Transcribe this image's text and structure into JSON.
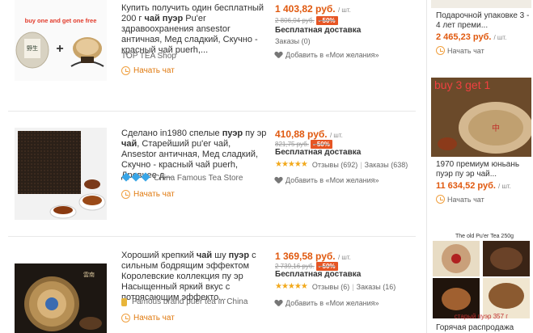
{
  "items": [
    {
      "banner_text": "buy one and get one free",
      "title_pre": "Купить получить один бесплатный 200 г ",
      "title_bold": "чай пуэр",
      "title_post": " Pu'er здравоохранения ansestor античная, Мед сладкий, Скучно - красный чай puerh,...",
      "store": "TOP TEA Shop",
      "chat": "Начать чат",
      "price": "1 403,82 руб.",
      "unit": "/ шт.",
      "old_price": "2 806,04 руб.",
      "discount": "- 50%",
      "shipping": "Бесплатная доставка",
      "orders": "Заказы (0)",
      "wishlist": "Добавить в «Мои желания»"
    },
    {
      "title_pre": "Сделано in1980 спелые ",
      "title_bold": "пуэр",
      "title_mid": " пу эр ",
      "title_bold2": "чай",
      "title_post": ", Старейший pu'er чай, Ansestor античная, Мед сладкий, Скучно - красный чай puerh, Древнее д...",
      "store": "China Famous Tea Store",
      "chat": "Начать чат",
      "price": "410,88 руб.",
      "unit": "/ шт.",
      "old_price": "821,75 руб.",
      "discount": "- 50%",
      "shipping": "Бесплатная доставка",
      "rating_stars": "★★★★★",
      "reviews": "Отзывы (692)",
      "orders": "Заказы (638)",
      "wishlist": "Добавить в «Мои желания»"
    },
    {
      "title_pre": "Хороший крепкий ",
      "title_bold": "чай",
      "title_mid": " шу ",
      "title_bold2": "пуэр",
      "title_post": " с сильным бодрящим эффектом Королевские коллекция пу эр Насыщенный яркий вкус с потрясающим эффекто...",
      "store": "Famous brand puer tea in China",
      "chat": "Начать чат",
      "price": "1 369,58 руб.",
      "unit": "/ шт.",
      "old_price": "2 739,16 руб.",
      "discount": "- 50%",
      "shipping": "Бесплатная доставка",
      "rating_stars": "★★★★★",
      "reviews": "Отзывы (6)",
      "orders": "Заказы (16)",
      "wishlist": "Добавить в «Мои желания»"
    }
  ],
  "sidebar": [
    {
      "title": "Подарочной упаковке 3 - 4 лет преми...",
      "price": "2 465,23 руб.",
      "unit": "/ шт.",
      "chat": "Начать чат"
    },
    {
      "banner_text": "buy 3 get 1",
      "title": "1970 премиум юньань пуэр пу эр чай...",
      "price": "11 634,52 руб.",
      "unit": "/ шт.",
      "chat": "Начать чат"
    },
    {
      "banner_text": "The old Pu'er Tea 250g",
      "caption": "старый пуэр 357 г",
      "title": "Горячая распродажа"
    }
  ]
}
